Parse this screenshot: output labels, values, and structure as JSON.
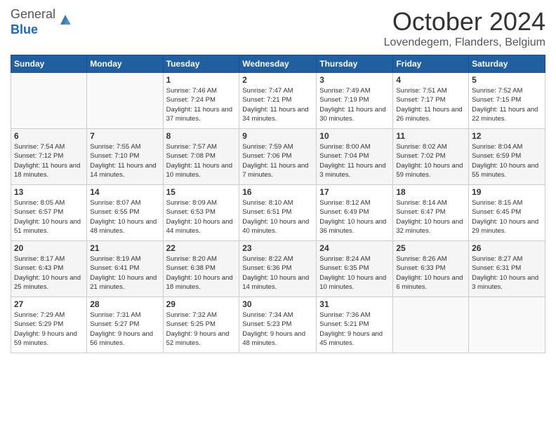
{
  "header": {
    "logo_general": "General",
    "logo_blue": "Blue",
    "month_title": "October 2024",
    "location": "Lovendegem, Flanders, Belgium"
  },
  "days_of_week": [
    "Sunday",
    "Monday",
    "Tuesday",
    "Wednesday",
    "Thursday",
    "Friday",
    "Saturday"
  ],
  "weeks": [
    [
      {
        "day": "",
        "sunrise": "",
        "sunset": "",
        "daylight": ""
      },
      {
        "day": "",
        "sunrise": "",
        "sunset": "",
        "daylight": ""
      },
      {
        "day": "1",
        "sunrise": "Sunrise: 7:46 AM",
        "sunset": "Sunset: 7:24 PM",
        "daylight": "Daylight: 11 hours and 37 minutes."
      },
      {
        "day": "2",
        "sunrise": "Sunrise: 7:47 AM",
        "sunset": "Sunset: 7:21 PM",
        "daylight": "Daylight: 11 hours and 34 minutes."
      },
      {
        "day": "3",
        "sunrise": "Sunrise: 7:49 AM",
        "sunset": "Sunset: 7:19 PM",
        "daylight": "Daylight: 11 hours and 30 minutes."
      },
      {
        "day": "4",
        "sunrise": "Sunrise: 7:51 AM",
        "sunset": "Sunset: 7:17 PM",
        "daylight": "Daylight: 11 hours and 26 minutes."
      },
      {
        "day": "5",
        "sunrise": "Sunrise: 7:52 AM",
        "sunset": "Sunset: 7:15 PM",
        "daylight": "Daylight: 11 hours and 22 minutes."
      }
    ],
    [
      {
        "day": "6",
        "sunrise": "Sunrise: 7:54 AM",
        "sunset": "Sunset: 7:12 PM",
        "daylight": "Daylight: 11 hours and 18 minutes."
      },
      {
        "day": "7",
        "sunrise": "Sunrise: 7:55 AM",
        "sunset": "Sunset: 7:10 PM",
        "daylight": "Daylight: 11 hours and 14 minutes."
      },
      {
        "day": "8",
        "sunrise": "Sunrise: 7:57 AM",
        "sunset": "Sunset: 7:08 PM",
        "daylight": "Daylight: 11 hours and 10 minutes."
      },
      {
        "day": "9",
        "sunrise": "Sunrise: 7:59 AM",
        "sunset": "Sunset: 7:06 PM",
        "daylight": "Daylight: 11 hours and 7 minutes."
      },
      {
        "day": "10",
        "sunrise": "Sunrise: 8:00 AM",
        "sunset": "Sunset: 7:04 PM",
        "daylight": "Daylight: 11 hours and 3 minutes."
      },
      {
        "day": "11",
        "sunrise": "Sunrise: 8:02 AM",
        "sunset": "Sunset: 7:02 PM",
        "daylight": "Daylight: 10 hours and 59 minutes."
      },
      {
        "day": "12",
        "sunrise": "Sunrise: 8:04 AM",
        "sunset": "Sunset: 6:59 PM",
        "daylight": "Daylight: 10 hours and 55 minutes."
      }
    ],
    [
      {
        "day": "13",
        "sunrise": "Sunrise: 8:05 AM",
        "sunset": "Sunset: 6:57 PM",
        "daylight": "Daylight: 10 hours and 51 minutes."
      },
      {
        "day": "14",
        "sunrise": "Sunrise: 8:07 AM",
        "sunset": "Sunset: 6:55 PM",
        "daylight": "Daylight: 10 hours and 48 minutes."
      },
      {
        "day": "15",
        "sunrise": "Sunrise: 8:09 AM",
        "sunset": "Sunset: 6:53 PM",
        "daylight": "Daylight: 10 hours and 44 minutes."
      },
      {
        "day": "16",
        "sunrise": "Sunrise: 8:10 AM",
        "sunset": "Sunset: 6:51 PM",
        "daylight": "Daylight: 10 hours and 40 minutes."
      },
      {
        "day": "17",
        "sunrise": "Sunrise: 8:12 AM",
        "sunset": "Sunset: 6:49 PM",
        "daylight": "Daylight: 10 hours and 36 minutes."
      },
      {
        "day": "18",
        "sunrise": "Sunrise: 8:14 AM",
        "sunset": "Sunset: 6:47 PM",
        "daylight": "Daylight: 10 hours and 32 minutes."
      },
      {
        "day": "19",
        "sunrise": "Sunrise: 8:15 AM",
        "sunset": "Sunset: 6:45 PM",
        "daylight": "Daylight: 10 hours and 29 minutes."
      }
    ],
    [
      {
        "day": "20",
        "sunrise": "Sunrise: 8:17 AM",
        "sunset": "Sunset: 6:43 PM",
        "daylight": "Daylight: 10 hours and 25 minutes."
      },
      {
        "day": "21",
        "sunrise": "Sunrise: 8:19 AM",
        "sunset": "Sunset: 6:41 PM",
        "daylight": "Daylight: 10 hours and 21 minutes."
      },
      {
        "day": "22",
        "sunrise": "Sunrise: 8:20 AM",
        "sunset": "Sunset: 6:38 PM",
        "daylight": "Daylight: 10 hours and 18 minutes."
      },
      {
        "day": "23",
        "sunrise": "Sunrise: 8:22 AM",
        "sunset": "Sunset: 6:36 PM",
        "daylight": "Daylight: 10 hours and 14 minutes."
      },
      {
        "day": "24",
        "sunrise": "Sunrise: 8:24 AM",
        "sunset": "Sunset: 6:35 PM",
        "daylight": "Daylight: 10 hours and 10 minutes."
      },
      {
        "day": "25",
        "sunrise": "Sunrise: 8:26 AM",
        "sunset": "Sunset: 6:33 PM",
        "daylight": "Daylight: 10 hours and 6 minutes."
      },
      {
        "day": "26",
        "sunrise": "Sunrise: 8:27 AM",
        "sunset": "Sunset: 6:31 PM",
        "daylight": "Daylight: 10 hours and 3 minutes."
      }
    ],
    [
      {
        "day": "27",
        "sunrise": "Sunrise: 7:29 AM",
        "sunset": "Sunset: 5:29 PM",
        "daylight": "Daylight: 9 hours and 59 minutes."
      },
      {
        "day": "28",
        "sunrise": "Sunrise: 7:31 AM",
        "sunset": "Sunset: 5:27 PM",
        "daylight": "Daylight: 9 hours and 56 minutes."
      },
      {
        "day": "29",
        "sunrise": "Sunrise: 7:32 AM",
        "sunset": "Sunset: 5:25 PM",
        "daylight": "Daylight: 9 hours and 52 minutes."
      },
      {
        "day": "30",
        "sunrise": "Sunrise: 7:34 AM",
        "sunset": "Sunset: 5:23 PM",
        "daylight": "Daylight: 9 hours and 48 minutes."
      },
      {
        "day": "31",
        "sunrise": "Sunrise: 7:36 AM",
        "sunset": "Sunset: 5:21 PM",
        "daylight": "Daylight: 9 hours and 45 minutes."
      },
      {
        "day": "",
        "sunrise": "",
        "sunset": "",
        "daylight": ""
      },
      {
        "day": "",
        "sunrise": "",
        "sunset": "",
        "daylight": ""
      }
    ]
  ]
}
